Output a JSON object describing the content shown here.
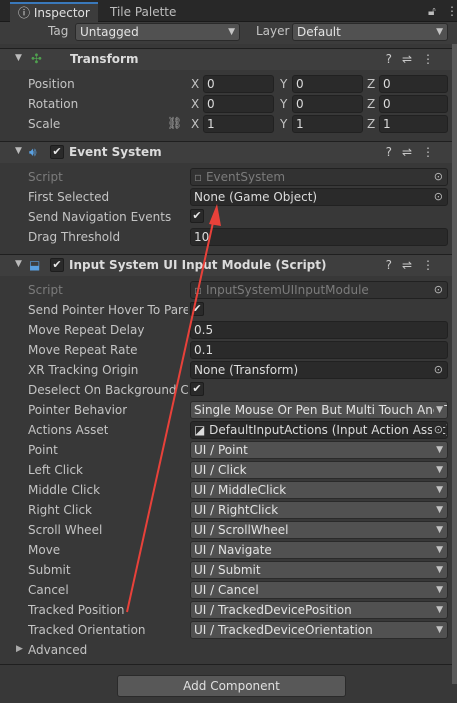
{
  "tabs": {
    "inspector": "Inspector",
    "tile_palette": "Tile Palette"
  },
  "tag_layer": {
    "tag_label": "Tag",
    "tag_value": "Untagged",
    "layer_label": "Layer",
    "layer_value": "Default"
  },
  "transform": {
    "title": "Transform",
    "rows": [
      {
        "label": "Position",
        "x": "0",
        "y": "0",
        "z": "0"
      },
      {
        "label": "Rotation",
        "x": "0",
        "y": "0",
        "z": "0"
      },
      {
        "label": "Scale",
        "x": "1",
        "y": "1",
        "z": "1"
      }
    ],
    "axis": {
      "x": "X",
      "y": "Y",
      "z": "Z"
    }
  },
  "event_system": {
    "title": "Event System",
    "script_label": "Script",
    "script_value": "EventSystem",
    "first_selected_label": "First Selected",
    "first_selected_value": "None (Game Object)",
    "send_nav_label": "Send Navigation Events",
    "drag_threshold_label": "Drag Threshold",
    "drag_threshold_value": "10"
  },
  "input_module": {
    "title": "Input System UI Input Module (Script)",
    "script_label": "Script",
    "script_value": "InputSystemUIInputModule",
    "send_pointer_label": "Send Pointer Hover To Parer",
    "move_repeat_delay_label": "Move Repeat Delay",
    "move_repeat_delay_value": "0.5",
    "move_repeat_rate_label": "Move Repeat Rate",
    "move_repeat_rate_value": "0.1",
    "xr_origin_label": "XR Tracking Origin",
    "xr_origin_value": "None (Transform)",
    "deselect_label": "Deselect On Background Cli",
    "pointer_behavior_label": "Pointer Behavior",
    "pointer_behavior_value": "Single Mouse Or Pen But Multi Touch And T",
    "actions_asset_label": "Actions Asset",
    "actions_asset_value": "DefaultInputActions (Input Action Asset)",
    "actions": [
      {
        "label": "Point",
        "value": "UI / Point"
      },
      {
        "label": "Left Click",
        "value": "UI / Click"
      },
      {
        "label": "Middle Click",
        "value": "UI / MiddleClick"
      },
      {
        "label": "Right Click",
        "value": "UI / RightClick"
      },
      {
        "label": "Scroll Wheel",
        "value": "UI / ScrollWheel"
      },
      {
        "label": "Move",
        "value": "UI / Navigate"
      },
      {
        "label": "Submit",
        "value": "UI / Submit"
      },
      {
        "label": "Cancel",
        "value": "UI / Cancel"
      },
      {
        "label": "Tracked Position",
        "value": "UI / TrackedDevicePosition"
      },
      {
        "label": "Tracked Orientation",
        "value": "UI / TrackedDeviceOrientation"
      }
    ],
    "advanced_label": "Advanced"
  },
  "add_component_label": "Add Component",
  "colors": {
    "annotation_arrow": "#e8413a",
    "accent": "#3a79bb"
  },
  "icons": [
    "info-icon",
    "lock-icon",
    "more-icon",
    "transform-icon",
    "event-system-icon",
    "input-module-icon",
    "help-icon",
    "presets-icon",
    "target-icon",
    "unlink-icon"
  ]
}
